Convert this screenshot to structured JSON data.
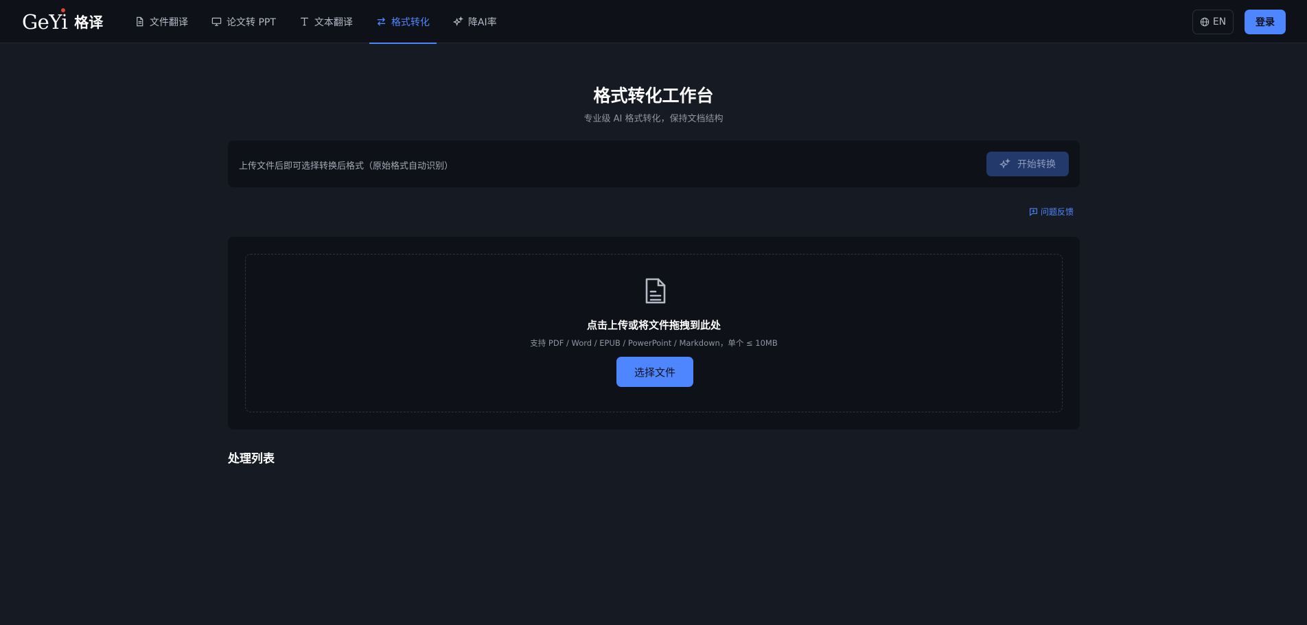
{
  "brand": {
    "latin": "GeYi",
    "cjk": "格译"
  },
  "nav": {
    "items": [
      {
        "label": "文件翻译",
        "icon": "file-icon",
        "active": false
      },
      {
        "label": "论文转 PPT",
        "icon": "presentation-icon",
        "active": false
      },
      {
        "label": "文本翻译",
        "icon": "text-icon",
        "active": false
      },
      {
        "label": "格式转化",
        "icon": "swap-icon",
        "active": true
      },
      {
        "label": "降AI率",
        "icon": "sparkles-icon",
        "active": false
      }
    ]
  },
  "header": {
    "lang_label": "EN",
    "login_label": "登录"
  },
  "page": {
    "title": "格式转化工作台",
    "subtitle": "专业级 AI 格式转化，保持文档结构"
  },
  "hint_bar": {
    "text": "上传文件后即可选择转换后格式（原始格式自动识别）",
    "start_label": "开始转换"
  },
  "feedback": {
    "label": "问题反馈"
  },
  "upload": {
    "title": "点击上传或将文件拖拽到此处",
    "subtitle": "支持 PDF / Word / EPUB / PowerPoint / Markdown，单个 ≤ 10MB",
    "button_label": "选择文件"
  },
  "list": {
    "title": "处理列表"
  },
  "colors": {
    "accent": "#4e86ff",
    "background": "#161a22",
    "panel": "#0e1118"
  }
}
